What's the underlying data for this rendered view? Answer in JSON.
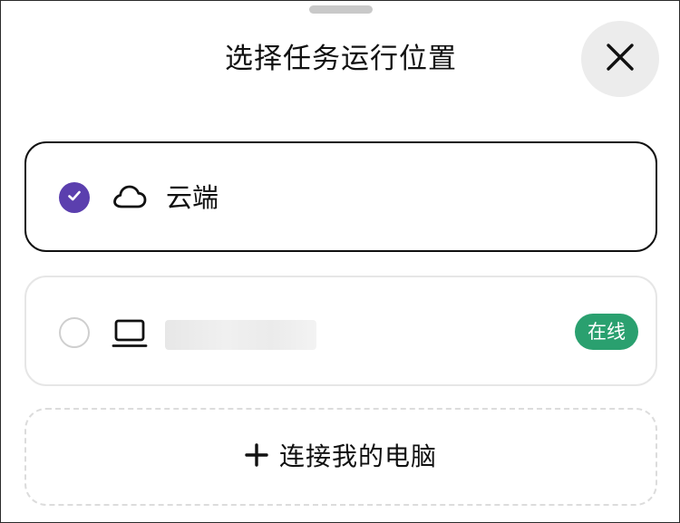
{
  "dialog": {
    "title": "选择任务运行位置",
    "close_icon": "close-icon"
  },
  "options": [
    {
      "label": "云端",
      "icon": "cloud-icon",
      "selected": true,
      "accent_color": "#5b3fae"
    },
    {
      "label": "",
      "icon": "laptop-icon",
      "selected": false,
      "status": "在线",
      "status_color": "#2aa06f"
    }
  ],
  "connect": {
    "label": "连接我的电脑",
    "icon": "plus-icon"
  }
}
